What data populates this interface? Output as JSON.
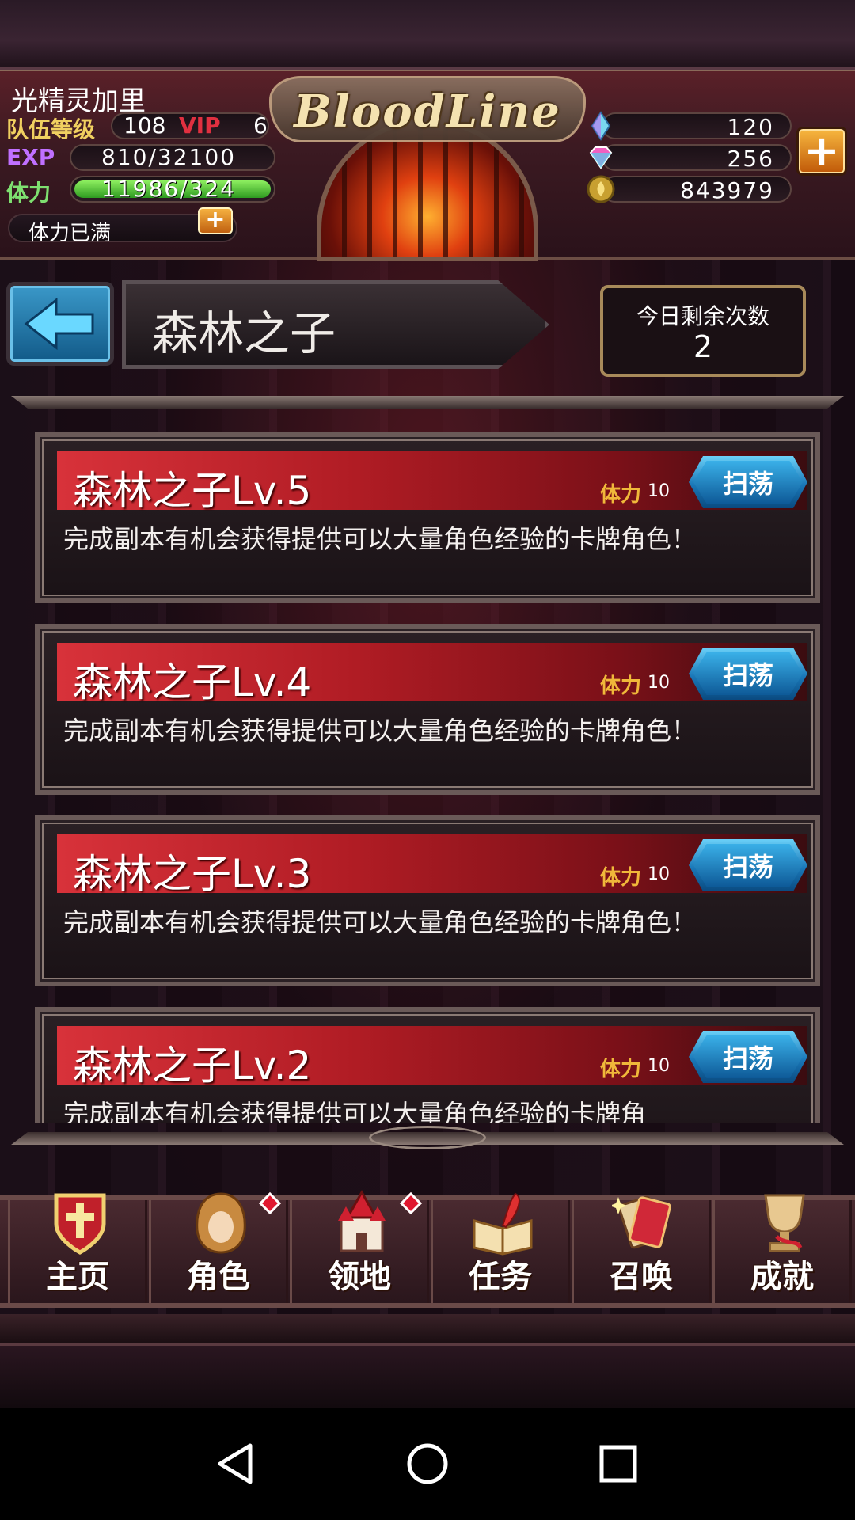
{
  "header": {
    "player_name": "光精灵加里",
    "team_level_label": "队伍等级",
    "team_level": "108",
    "vip_label": "VIP",
    "vip_level": "6",
    "exp_label": "EXP",
    "exp_value": "810/32100",
    "stamina_label": "体力",
    "stamina_value": "11986/324",
    "stamina_fill_fraction": 1.0,
    "stamina_status": "体力已满",
    "logo_text": "BloodLine",
    "resources": [
      {
        "icon": "crystal-icon",
        "value": "120"
      },
      {
        "icon": "diamond-icon",
        "value": "256"
      },
      {
        "icon": "gold-coin-icon",
        "value": "843979"
      }
    ]
  },
  "stage": {
    "title": "森林之子",
    "remaining_label": "今日剩余次数",
    "remaining_value": "2"
  },
  "levels": [
    {
      "title": "森林之子Lv.5",
      "cost_label": "体力",
      "cost": "10",
      "button": "扫荡",
      "desc": "完成副本有机会获得提供可以大量角色经验的卡牌角色！"
    },
    {
      "title": "森林之子Lv.4",
      "cost_label": "体力",
      "cost": "10",
      "button": "扫荡",
      "desc": "完成副本有机会获得提供可以大量角色经验的卡牌角色！"
    },
    {
      "title": "森林之子Lv.3",
      "cost_label": "体力",
      "cost": "10",
      "button": "扫荡",
      "desc": "完成副本有机会获得提供可以大量角色经验的卡牌角色！"
    },
    {
      "title": "森林之子Lv.2",
      "cost_label": "体力",
      "cost": "10",
      "button": "扫荡",
      "desc": "完成副本有机会获得提供可以大量角色经验的卡牌角"
    }
  ],
  "nav": [
    {
      "label": "主页",
      "icon": "home-shield-icon",
      "badge": false
    },
    {
      "label": "角色",
      "icon": "character-icon",
      "badge": true
    },
    {
      "label": "领地",
      "icon": "castle-icon",
      "badge": true
    },
    {
      "label": "任务",
      "icon": "quest-book-icon",
      "badge": false
    },
    {
      "label": "召唤",
      "icon": "summon-cards-icon",
      "badge": false
    },
    {
      "label": "成就",
      "icon": "trophy-icon",
      "badge": false
    }
  ],
  "colors": {
    "accent_red": "#c0232b",
    "button_blue": "#1a78b8",
    "gold": "#f0b83a"
  }
}
